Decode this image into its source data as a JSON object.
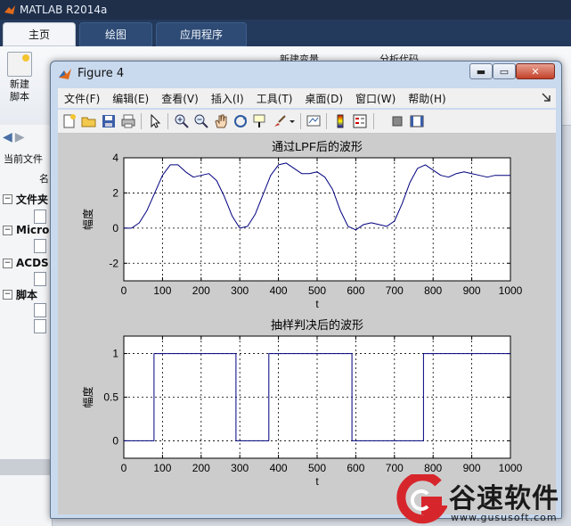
{
  "app": {
    "title": "MATLAB R2014a"
  },
  "tabs": [
    {
      "label": "主页"
    },
    {
      "label": "绘图"
    },
    {
      "label": "应用程序"
    }
  ],
  "ribbon": {
    "new_script_line1": "新建",
    "new_script_line2": "脚本",
    "new_variable": "新建变量",
    "analyze_code": "分析代码"
  },
  "left_panel": {
    "current_folder": "当前文件",
    "name_col": "名",
    "folders": [
      {
        "label": "文件夹"
      },
      {
        "label": "Micro"
      },
      {
        "label": "ACDS"
      },
      {
        "label": "脚本"
      }
    ]
  },
  "figure": {
    "title": "Figure 4",
    "menus": [
      "文件(F)",
      "编辑(E)",
      "查看(V)",
      "插入(I)",
      "工具(T)",
      "桌面(D)",
      "窗口(W)",
      "帮助(H)"
    ]
  },
  "colors": {
    "line": "#00007f",
    "canvas": "#cccccc",
    "axes_bg": "#ffffff"
  },
  "chart_data": [
    {
      "type": "line",
      "title": "通过LPF后的波形",
      "xlabel": "t",
      "ylabel": "幅度",
      "xlim": [
        0,
        1000
      ],
      "ylim": [
        -3,
        4
      ],
      "xticks": [
        0,
        100,
        200,
        300,
        400,
        500,
        600,
        700,
        800,
        900,
        1000
      ],
      "yticks": [
        -2,
        0,
        2,
        4
      ],
      "grid": true,
      "series": [
        {
          "x": [
            0,
            20,
            40,
            60,
            80,
            100,
            120,
            140,
            160,
            180,
            200,
            220,
            240,
            260,
            280,
            300,
            320,
            340,
            360,
            380,
            400,
            420,
            440,
            460,
            480,
            500,
            520,
            540,
            560,
            580,
            600,
            620,
            640,
            660,
            680,
            700,
            720,
            740,
            760,
            780,
            800,
            820,
            840,
            860,
            880,
            900,
            920,
            940,
            960,
            980,
            1000
          ],
          "y": [
            0,
            0,
            0.3,
            1.0,
            2.0,
            3.0,
            3.6,
            3.6,
            3.2,
            2.9,
            3.0,
            3.1,
            2.7,
            1.8,
            0.7,
            0,
            0.1,
            0.8,
            1.9,
            3.0,
            3.6,
            3.7,
            3.4,
            3.1,
            3.1,
            3.2,
            2.9,
            2.2,
            1.0,
            0.1,
            -0.1,
            0.2,
            0.3,
            0.2,
            0.1,
            0.4,
            1.4,
            2.6,
            3.4,
            3.6,
            3.3,
            3.0,
            2.9,
            3.1,
            3.2,
            3.1,
            3.0,
            2.9,
            3.0,
            3.0,
            3.0
          ]
        }
      ]
    },
    {
      "type": "line",
      "title": "抽样判决后的波形",
      "xlabel": "t",
      "ylabel": "幅度",
      "xlim": [
        0,
        1000
      ],
      "ylim": [
        -0.2,
        1.2
      ],
      "xticks": [
        0,
        100,
        200,
        300,
        400,
        500,
        600,
        700,
        800,
        900,
        1000
      ],
      "yticks": [
        0,
        0.5,
        1
      ],
      "grid": true,
      "series": [
        {
          "x": [
            0,
            78,
            78,
            290,
            290,
            375,
            375,
            590,
            590,
            775,
            775,
            1000
          ],
          "y": [
            0,
            0,
            1,
            1,
            0,
            0,
            1,
            1,
            0,
            0,
            1,
            1
          ]
        }
      ]
    }
  ],
  "watermark": {
    "brand": "谷速软件",
    "url": "www.gususoft.com"
  }
}
